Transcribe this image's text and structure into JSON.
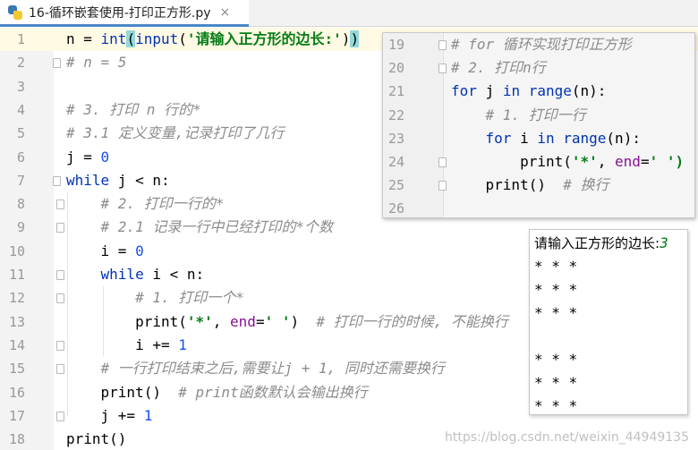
{
  "tab": {
    "icon": "python-file-icon",
    "title": "16-循环嵌套使用-打印正方形.py",
    "close_glyph": "×"
  },
  "lines": [
    {
      "n": "1",
      "parts": [
        [
          "n = ",
          ""
        ],
        [
          "int",
          "bi"
        ],
        [
          "(",
          "hl"
        ],
        [
          "input",
          "bi"
        ],
        [
          "(",
          ""
        ],
        [
          "'请输入正方形的边长:'",
          "str"
        ],
        [
          ")",
          ""
        ],
        [
          ")",
          "hl"
        ]
      ]
    },
    {
      "n": "2",
      "parts": [
        [
          "# n = 5",
          "cmt"
        ]
      ]
    },
    {
      "n": "3",
      "parts": []
    },
    {
      "n": "4",
      "parts": [
        [
          "# 3. 打印 n 行的*",
          "cmt"
        ]
      ]
    },
    {
      "n": "5",
      "parts": [
        [
          "# 3.1 定义变量,记录打印了几行",
          "cmt"
        ]
      ]
    },
    {
      "n": "6",
      "parts": [
        [
          "j = ",
          ""
        ],
        [
          "0",
          "num"
        ]
      ]
    },
    {
      "n": "7",
      "parts": [
        [
          "while",
          "kw"
        ],
        [
          " j < n:",
          ""
        ]
      ]
    },
    {
      "n": "8",
      "parts": [
        [
          "    # 2. 打印一行的*",
          "cmt"
        ]
      ]
    },
    {
      "n": "9",
      "parts": [
        [
          "    # 2.1 记录一行中已经打印的*个数",
          "cmt"
        ]
      ]
    },
    {
      "n": "10",
      "parts": [
        [
          "    i = ",
          ""
        ],
        [
          "0",
          "num"
        ]
      ]
    },
    {
      "n": "11",
      "parts": [
        [
          "    ",
          ""
        ],
        [
          "while",
          "kw"
        ],
        [
          " i < n:",
          ""
        ]
      ]
    },
    {
      "n": "12",
      "parts": [
        [
          "        # 1. 打印一个*",
          "cmt"
        ]
      ]
    },
    {
      "n": "13",
      "parts": [
        [
          "        print(",
          ""
        ],
        [
          "'*'",
          "str"
        ],
        [
          ", ",
          ""
        ],
        [
          "end",
          "kwarg"
        ],
        [
          "=",
          ""
        ],
        [
          "' '",
          "str"
        ],
        [
          ")  ",
          ""
        ],
        [
          "# 打印一行的时候, 不能换行",
          "cmt"
        ]
      ]
    },
    {
      "n": "14",
      "parts": [
        [
          "        i += ",
          ""
        ],
        [
          "1",
          "num"
        ]
      ]
    },
    {
      "n": "15",
      "parts": [
        [
          "    # 一行打印结束之后,需要让j + 1, 同时还需要换行",
          "cmt"
        ]
      ]
    },
    {
      "n": "16",
      "parts": [
        [
          "    print()  ",
          ""
        ],
        [
          "# print函数默认会输出换行",
          "cmt"
        ]
      ]
    },
    {
      "n": "17",
      "parts": [
        [
          "    j += ",
          ""
        ],
        [
          "1",
          "num"
        ]
      ]
    },
    {
      "n": "18",
      "parts": [
        [
          "print()",
          ""
        ]
      ]
    }
  ],
  "popup_lines": [
    {
      "n": "19",
      "parts": [
        [
          "# for 循环实现打印正方形",
          "cmt"
        ]
      ]
    },
    {
      "n": "20",
      "parts": [
        [
          "# 2. 打印n行",
          "cmt"
        ]
      ]
    },
    {
      "n": "21",
      "parts": [
        [
          "for",
          "kw"
        ],
        [
          " j ",
          ""
        ],
        [
          "in",
          "kw"
        ],
        [
          " ",
          ""
        ],
        [
          "range",
          "bi"
        ],
        [
          "(n):",
          ""
        ]
      ]
    },
    {
      "n": "22",
      "parts": [
        [
          "    # 1. 打印一行",
          "cmt"
        ]
      ]
    },
    {
      "n": "23",
      "parts": [
        [
          "    ",
          ""
        ],
        [
          "for",
          "kw"
        ],
        [
          " i ",
          ""
        ],
        [
          "in",
          "kw"
        ],
        [
          " ",
          ""
        ],
        [
          "range",
          "bi"
        ],
        [
          "(n):",
          ""
        ]
      ]
    },
    {
      "n": "24",
      "parts": [
        [
          "        print(",
          ""
        ],
        [
          "'*'",
          "str"
        ],
        [
          ", ",
          ""
        ],
        [
          "end",
          "kwarg"
        ],
        [
          "=",
          ""
        ],
        [
          "' ')",
          "str"
        ]
      ]
    },
    {
      "n": "25",
      "parts": [
        [
          "    print()  ",
          ""
        ],
        [
          "# 换行",
          "cmt"
        ]
      ]
    },
    {
      "n": "26",
      "parts": []
    }
  ],
  "console": {
    "prompt": "请输入正方形的边长:",
    "input_value": "3",
    "output_lines": [
      "* * *",
      "* * *",
      "* * *",
      "",
      "* * *",
      "* * *",
      "* * *"
    ]
  },
  "watermark": "https://blog.csdn.net/weixin_44949135"
}
